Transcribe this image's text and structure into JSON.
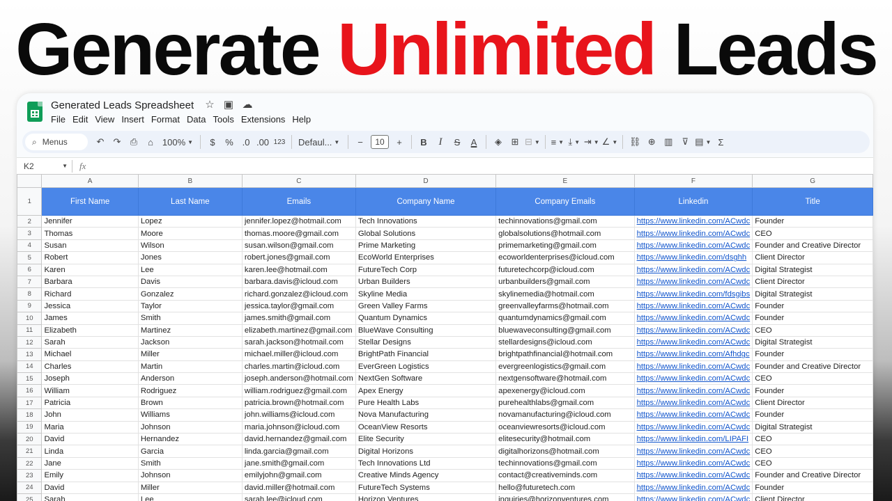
{
  "headline": {
    "part1": "Generate",
    "part2": "Unlimited",
    "part3": "Leads"
  },
  "app": {
    "title": "Generated Leads Spreadsheet",
    "menus": [
      "File",
      "Edit",
      "View",
      "Insert",
      "Format",
      "Data",
      "Tools",
      "Extensions",
      "Help"
    ]
  },
  "toolbar": {
    "search_label": "Menus",
    "zoom": "100%",
    "currency": "$",
    "percent": "%",
    "dec_decrease": ".0",
    "dec_increase": ".00",
    "number_format": "123",
    "font": "Defaul...",
    "font_size": "10",
    "bold": "B",
    "italic": "I",
    "strike": "S",
    "text_color": "A",
    "sum": "Σ"
  },
  "formula_bar": {
    "cell_ref": "K2",
    "fx": "fx"
  },
  "columns": [
    "A",
    "B",
    "C",
    "D",
    "E",
    "F",
    "G"
  ],
  "header_row": [
    "First Name",
    "Last Name",
    "Emails",
    "Company Name",
    "Company Emails",
    "Linkedin",
    "Title"
  ],
  "rows": [
    [
      "2",
      "Jennifer",
      "Lopez",
      "jennifer.lopez@hotmail.com",
      "Tech Innovations",
      "techinnovations@gmail.com",
      "https://www.linkedin.com/ACwdc",
      "Founder"
    ],
    [
      "3",
      "Thomas",
      "Moore",
      "thomas.moore@gmail.com",
      "Global Solutions",
      "globalsolutions@hotmail.com",
      "https://www.linkedin.com/ACwdc",
      "CEO"
    ],
    [
      "4",
      "Susan",
      "Wilson",
      "susan.wilson@gmail.com",
      "Prime Marketing",
      "primemarketing@gmail.com",
      "https://www.linkedin.com/ACwdc",
      "Founder and Creative Director"
    ],
    [
      "5",
      "Robert",
      "Jones",
      "robert.jones@gmail.com",
      "EcoWorld Enterprises",
      "ecoworldenterprises@icloud.com",
      "https://www.linkedin.com/dsghh",
      "Client Director"
    ],
    [
      "6",
      "Karen",
      "Lee",
      "karen.lee@hotmail.com",
      "FutureTech Corp",
      "futuretechcorp@icloud.com",
      "https://www.linkedin.com/ACwdc",
      "Digital Strategist"
    ],
    [
      "7",
      "Barbara",
      "Davis",
      "barbara.davis@icloud.com",
      "Urban Builders",
      "urbanbuilders@gmail.com",
      "https://www.linkedin.com/ACwdc",
      "Client Director"
    ],
    [
      "8",
      "Richard",
      "Gonzalez",
      "richard.gonzalez@icloud.com",
      "Skyline Media",
      "skylinemedia@hotmail.com",
      "https://www.linkedin.com/fdsgibs",
      "Digital Strategist"
    ],
    [
      "9",
      "Jessica",
      "Taylor",
      "jessica.taylor@gmail.com",
      "Green Valley Farms",
      "greenvalleyfarms@hotmail.com",
      "https://www.linkedin.com/ACwdc",
      "Founder"
    ],
    [
      "10",
      "James",
      "Smith",
      "james.smith@gmail.com",
      "Quantum Dynamics",
      "quantumdynamics@gmail.com",
      "https://www.linkedin.com/ACwdc",
      "Founder"
    ],
    [
      "11",
      "Elizabeth",
      "Martinez",
      "elizabeth.martinez@gmail.com",
      "BlueWave Consulting",
      "bluewaveconsulting@gmail.com",
      "https://www.linkedin.com/ACwdc",
      "CEO"
    ],
    [
      "12",
      "Sarah",
      "Jackson",
      "sarah.jackson@hotmail.com",
      "Stellar Designs",
      "stellardesigns@icloud.com",
      "https://www.linkedin.com/ACwdc",
      "Digital Strategist"
    ],
    [
      "13",
      "Michael",
      "Miller",
      "michael.miller@icloud.com",
      "BrightPath Financial",
      "brightpathfinancial@hotmail.com",
      "https://www.linkedin.com/Afhdgc",
      "Founder"
    ],
    [
      "14",
      "Charles",
      "Martin",
      "charles.martin@icloud.com",
      "EverGreen Logistics",
      "evergreenlogistics@gmail.com",
      "https://www.linkedin.com/ACwdc",
      "Founder and Creative Director"
    ],
    [
      "15",
      "Joseph",
      "Anderson",
      "joseph.anderson@hotmail.com",
      "NextGen Software",
      "nextgensoftware@hotmail.com",
      "https://www.linkedin.com/ACwdc",
      "CEO"
    ],
    [
      "16",
      "William",
      "Rodriguez",
      "william.rodriguez@gmail.com",
      "Apex Energy",
      "apexenergy@icloud.com",
      "https://www.linkedin.com/ACwdc",
      "Founder"
    ],
    [
      "17",
      "Patricia",
      "Brown",
      "patricia.brown@hotmail.com",
      "Pure Health Labs",
      "purehealthlabs@gmail.com",
      "https://www.linkedin.com/ACwdc",
      "Client Director"
    ],
    [
      "18",
      "John",
      "Williams",
      "john.williams@icloud.com",
      "Nova Manufacturing",
      "novamanufacturing@icloud.com",
      "https://www.linkedin.com/ACwdc",
      "Founder"
    ],
    [
      "19",
      "Maria",
      "Johnson",
      "maria.johnson@icloud.com",
      "OceanView Resorts",
      "oceanviewresorts@icloud.com",
      "https://www.linkedin.com/ACwdc",
      "Digital Strategist"
    ],
    [
      "20",
      "David",
      "Hernandez",
      "david.hernandez@gmail.com",
      "Elite Security",
      "elitesecurity@hotmail.com",
      "https://www.linkedin.com/LIPAFI",
      "CEO"
    ],
    [
      "21",
      "Linda",
      "Garcia",
      "linda.garcia@gmail.com",
      "Digital Horizons",
      "digitalhorizons@hotmail.com",
      "https://www.linkedin.com/ACwdc",
      "CEO"
    ],
    [
      "22",
      "Jane",
      "Smith",
      "jane.smith@gmail.com",
      "Tech Innovations Ltd",
      "techinnovations@gmail.com",
      "https://www.linkedin.com/ACwdc",
      "CEO"
    ],
    [
      "23",
      "Emily",
      "Johnson",
      "emilyjohn@gmail.com",
      "Creative Minds Agency",
      "contact@creativeminds.com",
      "https://www.linkedin.com/ACwdc",
      "Founder and Creative Director"
    ],
    [
      "24",
      "David",
      "Miller",
      "david.miller@hotmail.com",
      "FutureTech Systems",
      "hello@futuretech.com",
      "https://www.linkedin.com/ACwdc",
      "Founder"
    ],
    [
      "25",
      "Sarah",
      "Lee",
      "sarah.lee@icloud.com",
      "Horizon Ventures",
      "inquiries@horizonventures.com",
      "https://www.linkedin.com/ACwdc",
      "Client Director"
    ]
  ],
  "colors": {
    "header_fill": "#4a86e8",
    "link": "#1155cc",
    "headline_red": "#e8141b",
    "sheets_green": "#0f9d58"
  }
}
